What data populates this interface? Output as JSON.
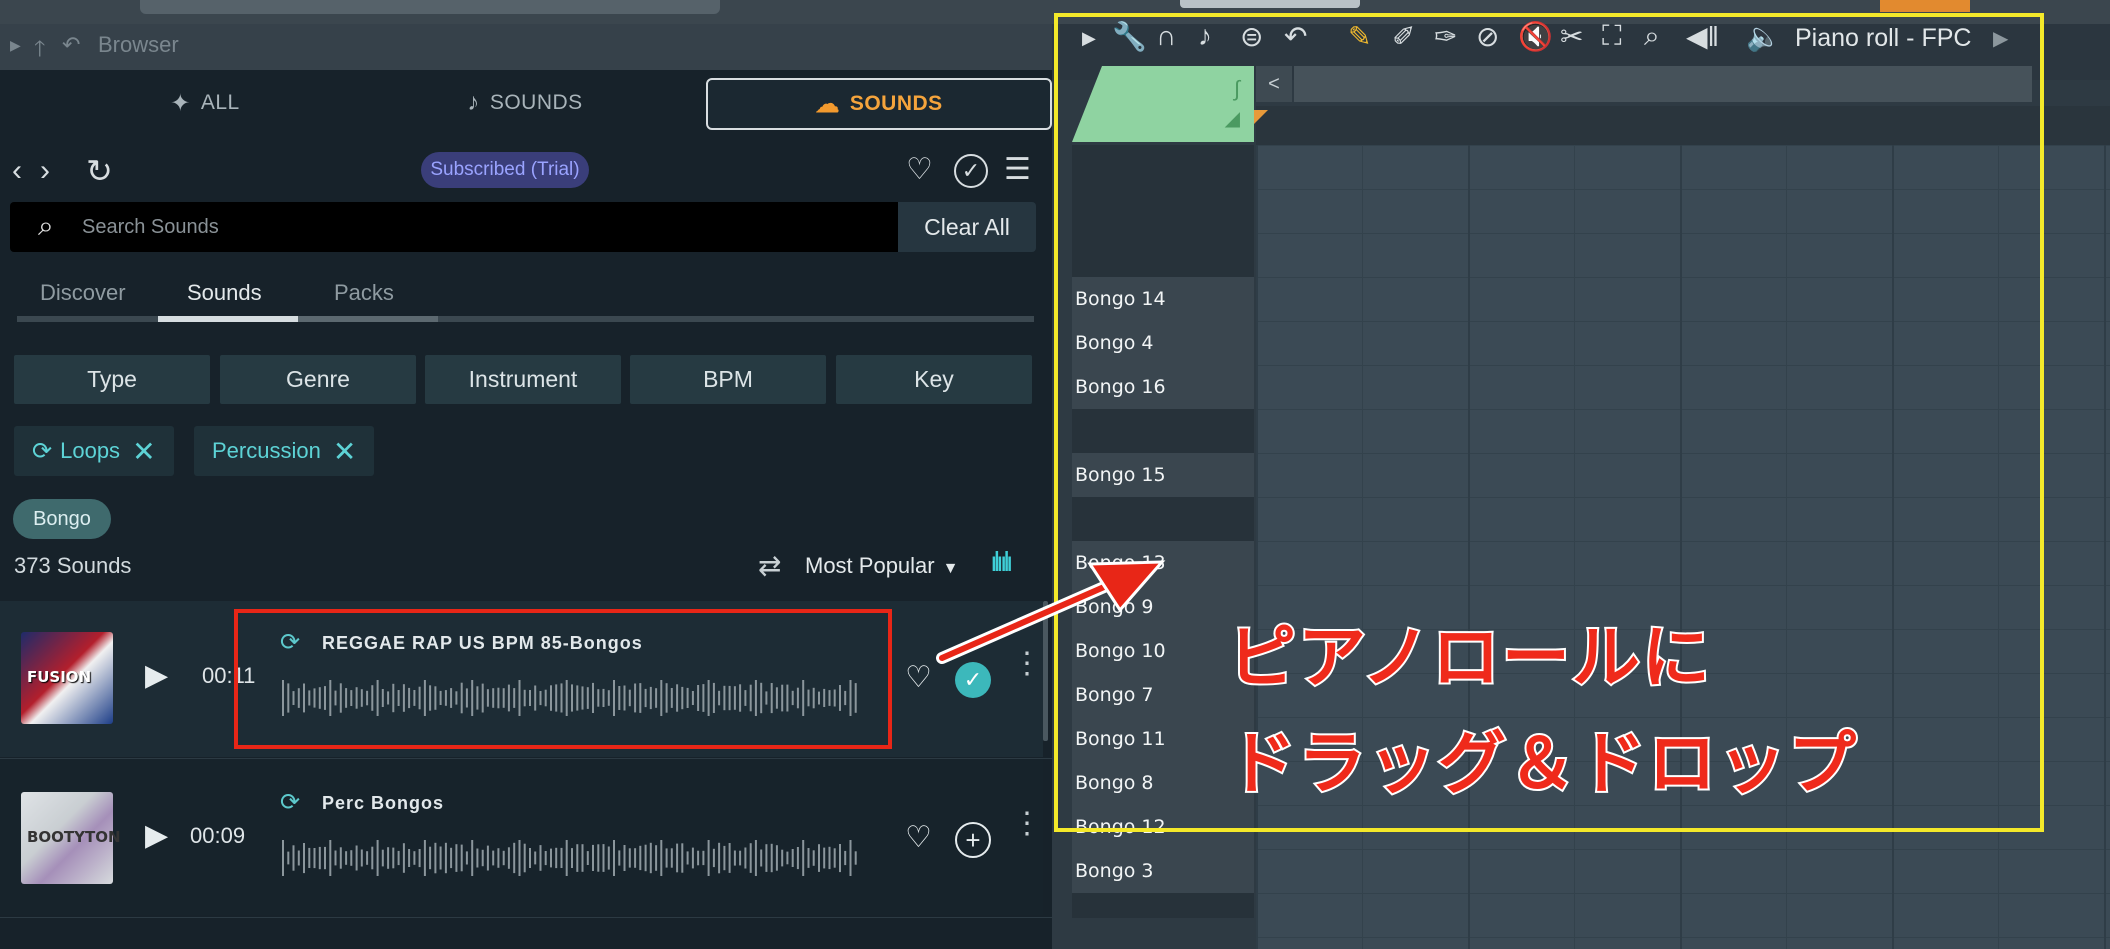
{
  "browser": {
    "header_label": "Browser",
    "main_tabs": [
      {
        "label": "ALL",
        "icon": "sparkle-icon"
      },
      {
        "label": "SOUNDS",
        "icon": "music-note-icon"
      },
      {
        "label": "SOUNDS",
        "icon": "cloud-icon",
        "selected": true
      }
    ],
    "subscription_badge": "Subscribed (Trial)",
    "search": {
      "placeholder": "Search Sounds",
      "clear_label": "Clear All"
    },
    "sub_tabs": [
      "Discover",
      "Sounds",
      "Packs"
    ],
    "selected_sub_tab": "Sounds",
    "filters": [
      "Type",
      "Genre",
      "Instrument",
      "BPM",
      "Key"
    ],
    "active_chips": [
      "Loops",
      "Percussion"
    ],
    "tag": "Bongo",
    "count": "373 Sounds",
    "sort": "Most Popular",
    "results": [
      {
        "title": "REGGAE RAP US BPM 85-Bongos",
        "duration": "00:11",
        "cover_text": "FUSION",
        "added": true
      },
      {
        "title": "Perc Bongos",
        "duration": "00:09",
        "cover_text": "BOOTYTON",
        "added": false
      }
    ]
  },
  "piano_roll": {
    "title": "Piano roll - FPC",
    "keys": [
      "",
      "",
      "",
      "Bongo 14",
      "Bongo 4",
      "Bongo 16",
      "",
      "Bongo 15",
      "",
      "Bongo 13",
      "Bongo 9",
      "Bongo 10",
      "Bongo 7",
      "Bongo 11",
      "Bongo 8",
      "Bongo 12",
      "Bongo 3"
    ]
  },
  "annotation": {
    "line1": "ピアノロールに",
    "line2": "ドラッグ＆ドロップ"
  },
  "colors": {
    "accent_orange": "#f5a43c",
    "teal": "#3cb8bb",
    "red_highlight": "#e82617",
    "yellow_highlight": "#f4e92a",
    "note_green": "#8fd3a1"
  }
}
